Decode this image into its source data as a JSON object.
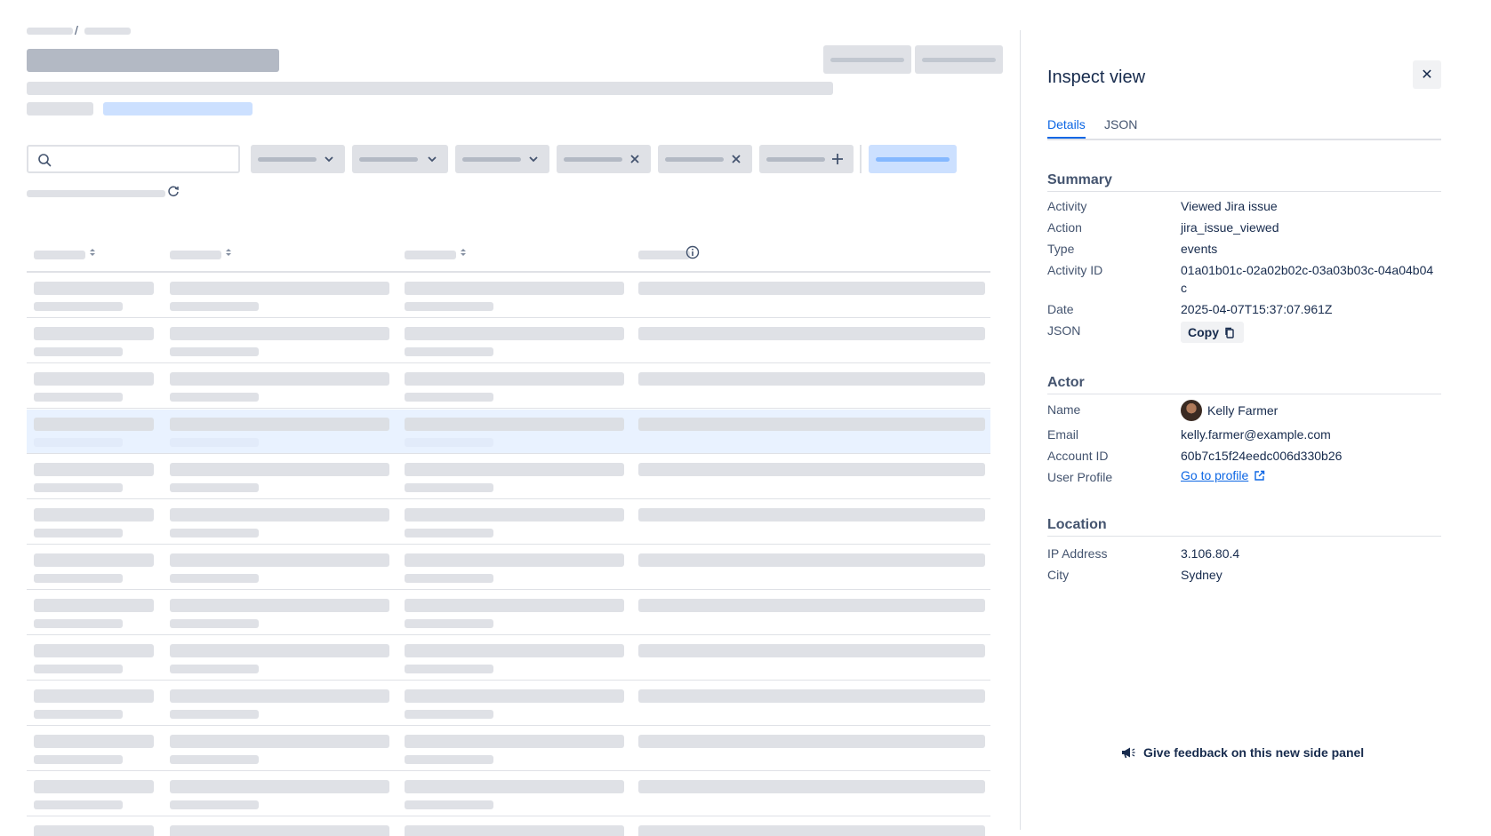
{
  "search": {
    "placeholder": ""
  },
  "table": {
    "row_count": 13,
    "selected_row_index": 3
  },
  "panel": {
    "title": "Inspect view",
    "close_icon": "close-icon",
    "tabs": [
      {
        "label": "Details",
        "active": true
      },
      {
        "label": "JSON",
        "active": false
      }
    ],
    "summary": {
      "title": "Summary",
      "activity_label": "Activity",
      "activity_value": "Viewed Jira issue",
      "action_label": "Action",
      "action_value": "jira_issue_viewed",
      "type_label": "Type",
      "type_value": "events",
      "activity_id_label": "Activity ID",
      "activity_id_value": "01a01b01c-02a02b02c-03a03b03c-04a04b04c",
      "date_label": "Date",
      "date_value": "2025-04-07T15:37:07.961Z",
      "json_label": "JSON",
      "copy_label": "Copy"
    },
    "actor": {
      "title": "Actor",
      "name_label": "Name",
      "name_value": "Kelly Farmer",
      "email_label": "Email",
      "email_value": "kelly.farmer@example.com",
      "account_id_label": "Account ID",
      "account_id_value": "60b7c15f24eedc006d330b26",
      "profile_label": "User Profile",
      "profile_link": "Go to profile"
    },
    "location": {
      "title": "Location",
      "ip_label": "IP Address",
      "ip_value": "3.106.80.4",
      "city_label": "City",
      "city_value": "Sydney"
    },
    "feedback_label": "Give feedback on this new side panel"
  },
  "colors": {
    "accent": "#0c66e4",
    "skeleton": "#dfe1e6",
    "selected_row": "#e9f2ff"
  }
}
